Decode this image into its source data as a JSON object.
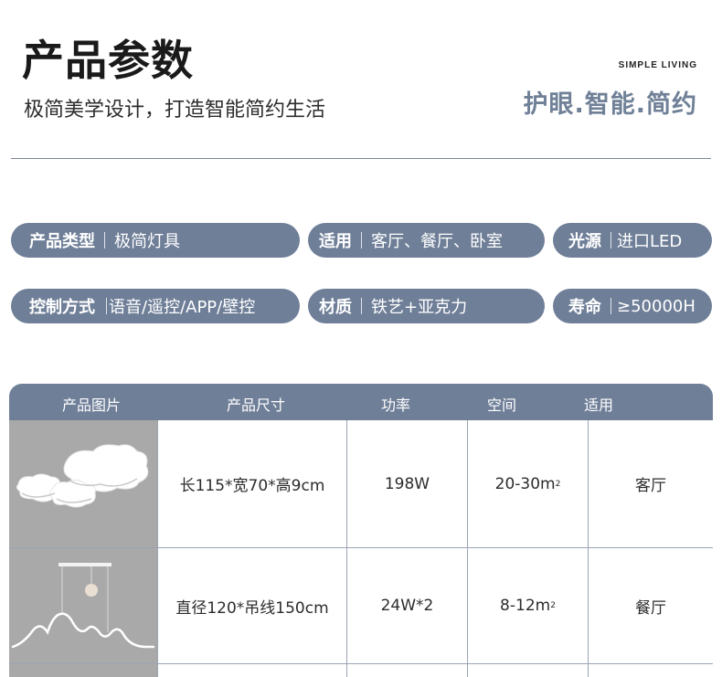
{
  "header": {
    "title": "产品参数",
    "subtitle": "极简美学设计，打造智能简约生活",
    "brand_en": "SIMPLE LIVING",
    "brand_cn": "护眼.智能.简约"
  },
  "specs": [
    {
      "key": "产品类型",
      "value": "极简灯具"
    },
    {
      "key": "适用",
      "value": "客厅、餐厅、卧室"
    },
    {
      "key": "光源",
      "value": "进口LED"
    },
    {
      "key": "控制方式",
      "value": "语音/遥控/APP/壁控"
    },
    {
      "key": "材质",
      "value": "铁艺+亚克力"
    },
    {
      "key": "寿命",
      "value": "≥50000H"
    }
  ],
  "table": {
    "headers": [
      "产品图片",
      "产品尺寸",
      "功率",
      "空间",
      "适用"
    ],
    "rows": [
      {
        "image": "cloud-ceiling-lamp",
        "size": "长115*宽70*高9cm",
        "power": "198W",
        "space": "20-30m",
        "space_sup": "2",
        "use": "客厅"
      },
      {
        "image": "wave-pendant-lamp",
        "size": "直径120*吊线150cm",
        "power": "24W*2",
        "space": "8-12m",
        "space_sup": "2",
        "use": "餐厅"
      }
    ]
  },
  "colors": {
    "accent": "#6f7f98",
    "image_bg": "#a9a9a9",
    "text": "#2c2c2c"
  }
}
